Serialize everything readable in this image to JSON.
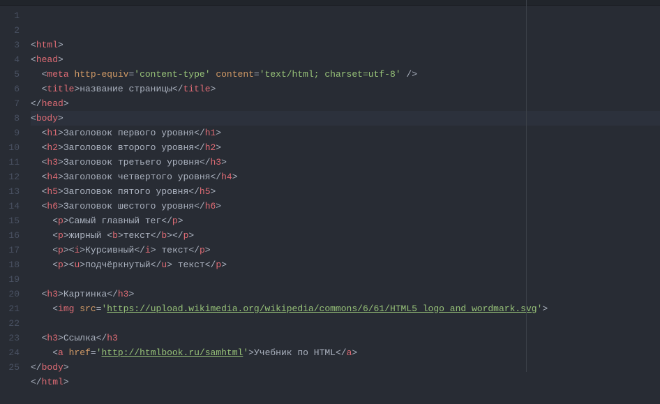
{
  "editor": {
    "active_line": 6,
    "ruler_column": 93,
    "lines": [
      {
        "n": 1,
        "indent": 0,
        "tokens": [
          [
            "br",
            "<"
          ],
          [
            "tag",
            "html"
          ],
          [
            "br",
            ">"
          ]
        ]
      },
      {
        "n": 2,
        "indent": 0,
        "tokens": [
          [
            "br",
            "<"
          ],
          [
            "tag",
            "head"
          ],
          [
            "br",
            ">"
          ]
        ]
      },
      {
        "n": 3,
        "indent": 1,
        "tokens": [
          [
            "br",
            "<"
          ],
          [
            "tag",
            "meta"
          ],
          [
            "txt",
            " "
          ],
          [
            "attr",
            "http-equiv"
          ],
          [
            "punc",
            "="
          ],
          [
            "str",
            "'content-type'"
          ],
          [
            "txt",
            " "
          ],
          [
            "attr",
            "content"
          ],
          [
            "punc",
            "="
          ],
          [
            "str",
            "'text/html; charset=utf-8'"
          ],
          [
            "txt",
            " "
          ],
          [
            "br",
            "/>"
          ]
        ]
      },
      {
        "n": 4,
        "indent": 1,
        "tokens": [
          [
            "br",
            "<"
          ],
          [
            "tag",
            "title"
          ],
          [
            "br",
            ">"
          ],
          [
            "txt",
            "название страницы"
          ],
          [
            "br",
            "</"
          ],
          [
            "tag",
            "title"
          ],
          [
            "br",
            ">"
          ]
        ]
      },
      {
        "n": 5,
        "indent": 0,
        "tokens": [
          [
            "br",
            "</"
          ],
          [
            "tag",
            "head"
          ],
          [
            "br",
            ">"
          ]
        ]
      },
      {
        "n": 6,
        "indent": 0,
        "tokens": [
          [
            "br",
            "<"
          ],
          [
            "tag",
            "body"
          ],
          [
            "br",
            ">"
          ]
        ]
      },
      {
        "n": 7,
        "indent": 1,
        "tokens": [
          [
            "br",
            "<"
          ],
          [
            "tag",
            "h1"
          ],
          [
            "br",
            ">"
          ],
          [
            "txt",
            "Заголовок первого уровня"
          ],
          [
            "br",
            "</"
          ],
          [
            "tag",
            "h1"
          ],
          [
            "br",
            ">"
          ]
        ]
      },
      {
        "n": 8,
        "indent": 1,
        "tokens": [
          [
            "br",
            "<"
          ],
          [
            "tag",
            "h2"
          ],
          [
            "br",
            ">"
          ],
          [
            "txt",
            "Заголовок второго уровня"
          ],
          [
            "br",
            "</"
          ],
          [
            "tag",
            "h2"
          ],
          [
            "br",
            ">"
          ]
        ]
      },
      {
        "n": 9,
        "indent": 1,
        "tokens": [
          [
            "br",
            "<"
          ],
          [
            "tag",
            "h3"
          ],
          [
            "br",
            ">"
          ],
          [
            "txt",
            "Заголовок третьего уровня"
          ],
          [
            "br",
            "</"
          ],
          [
            "tag",
            "h3"
          ],
          [
            "br",
            ">"
          ]
        ]
      },
      {
        "n": 10,
        "indent": 1,
        "tokens": [
          [
            "br",
            "<"
          ],
          [
            "tag",
            "h4"
          ],
          [
            "br",
            ">"
          ],
          [
            "txt",
            "Заголовок четвертого уровня"
          ],
          [
            "br",
            "</"
          ],
          [
            "tag",
            "h4"
          ],
          [
            "br",
            ">"
          ]
        ]
      },
      {
        "n": 11,
        "indent": 1,
        "tokens": [
          [
            "br",
            "<"
          ],
          [
            "tag",
            "h5"
          ],
          [
            "br",
            ">"
          ],
          [
            "txt",
            "Заголовок пятого уровня"
          ],
          [
            "br",
            "</"
          ],
          [
            "tag",
            "h5"
          ],
          [
            "br",
            ">"
          ]
        ]
      },
      {
        "n": 12,
        "indent": 1,
        "tokens": [
          [
            "br",
            "<"
          ],
          [
            "tag",
            "h6"
          ],
          [
            "br",
            ">"
          ],
          [
            "txt",
            "Заголовок шестого уровня"
          ],
          [
            "br",
            "</"
          ],
          [
            "tag",
            "h6"
          ],
          [
            "br",
            ">"
          ]
        ]
      },
      {
        "n": 13,
        "indent": 2,
        "tokens": [
          [
            "br",
            "<"
          ],
          [
            "tag",
            "p"
          ],
          [
            "br",
            ">"
          ],
          [
            "txt",
            "Самый главный тег"
          ],
          [
            "br",
            "</"
          ],
          [
            "tag",
            "p"
          ],
          [
            "br",
            ">"
          ]
        ]
      },
      {
        "n": 14,
        "indent": 2,
        "tokens": [
          [
            "br",
            "<"
          ],
          [
            "tag",
            "p"
          ],
          [
            "br",
            ">"
          ],
          [
            "txt",
            "жирный "
          ],
          [
            "br",
            "<"
          ],
          [
            "tag",
            "b"
          ],
          [
            "br",
            ">"
          ],
          [
            "txt",
            "текст"
          ],
          [
            "br",
            "</"
          ],
          [
            "tag",
            "b"
          ],
          [
            "br",
            ">"
          ],
          [
            "br",
            "</"
          ],
          [
            "tag",
            "p"
          ],
          [
            "br",
            ">"
          ]
        ]
      },
      {
        "n": 15,
        "indent": 2,
        "tokens": [
          [
            "br",
            "<"
          ],
          [
            "tag",
            "p"
          ],
          [
            "br",
            ">"
          ],
          [
            "br",
            "<"
          ],
          [
            "tag",
            "i"
          ],
          [
            "br",
            ">"
          ],
          [
            "txt",
            "Курсивный"
          ],
          [
            "br",
            "</"
          ],
          [
            "tag",
            "i"
          ],
          [
            "br",
            ">"
          ],
          [
            "txt",
            " текст"
          ],
          [
            "br",
            "</"
          ],
          [
            "tag",
            "p"
          ],
          [
            "br",
            ">"
          ]
        ]
      },
      {
        "n": 16,
        "indent": 2,
        "tokens": [
          [
            "br",
            "<"
          ],
          [
            "tag",
            "p"
          ],
          [
            "br",
            ">"
          ],
          [
            "br",
            "<"
          ],
          [
            "tag",
            "u"
          ],
          [
            "br",
            ">"
          ],
          [
            "txt",
            "подчёркнутый"
          ],
          [
            "br",
            "</"
          ],
          [
            "tag",
            "u"
          ],
          [
            "br",
            ">"
          ],
          [
            "txt",
            " текст"
          ],
          [
            "br",
            "</"
          ],
          [
            "tag",
            "p"
          ],
          [
            "br",
            ">"
          ]
        ]
      },
      {
        "n": 17,
        "indent": 0,
        "tokens": []
      },
      {
        "n": 18,
        "indent": 1,
        "tokens": [
          [
            "br",
            "<"
          ],
          [
            "tag",
            "h3"
          ],
          [
            "br",
            ">"
          ],
          [
            "txt",
            "Картинка"
          ],
          [
            "br",
            "</"
          ],
          [
            "tag",
            "h3"
          ],
          [
            "br",
            ">"
          ]
        ]
      },
      {
        "n": 19,
        "indent": 2,
        "tokens": [
          [
            "br",
            "<"
          ],
          [
            "tag",
            "img"
          ],
          [
            "txt",
            " "
          ],
          [
            "attr",
            "src"
          ],
          [
            "punc",
            "="
          ],
          [
            "str",
            "'"
          ],
          [
            "url",
            "https://upload.wikimedia.org/wikipedia/commons/6/61/HTML5_logo_and_wordmark.svg"
          ],
          [
            "str",
            "'"
          ],
          [
            "br",
            ">"
          ]
        ]
      },
      {
        "n": 20,
        "indent": 0,
        "tokens": []
      },
      {
        "n": 21,
        "indent": 1,
        "tokens": [
          [
            "br",
            "<"
          ],
          [
            "tag",
            "h3"
          ],
          [
            "br",
            ">"
          ],
          [
            "txt",
            "Ссылка"
          ],
          [
            "br",
            "</"
          ],
          [
            "tag",
            "h3"
          ]
        ]
      },
      {
        "n": 22,
        "indent": 2,
        "tokens": [
          [
            "br",
            "<"
          ],
          [
            "tag",
            "a"
          ],
          [
            "txt",
            " "
          ],
          [
            "attr",
            "href"
          ],
          [
            "punc",
            "="
          ],
          [
            "str",
            "'"
          ],
          [
            "url",
            "http://htmlbook.ru/samhtml"
          ],
          [
            "str",
            "'"
          ],
          [
            "br",
            ">"
          ],
          [
            "txt",
            "Учебник по HTML"
          ],
          [
            "br",
            "</"
          ],
          [
            "tag",
            "a"
          ],
          [
            "br",
            ">"
          ]
        ]
      },
      {
        "n": 23,
        "indent": 0,
        "tokens": [
          [
            "br",
            "</"
          ],
          [
            "tag",
            "body"
          ],
          [
            "br",
            ">"
          ]
        ]
      },
      {
        "n": 24,
        "indent": 0,
        "tokens": [
          [
            "br",
            "</"
          ],
          [
            "tag",
            "html"
          ],
          [
            "br",
            ">"
          ]
        ]
      },
      {
        "n": 25,
        "indent": 0,
        "tokens": []
      }
    ]
  }
}
